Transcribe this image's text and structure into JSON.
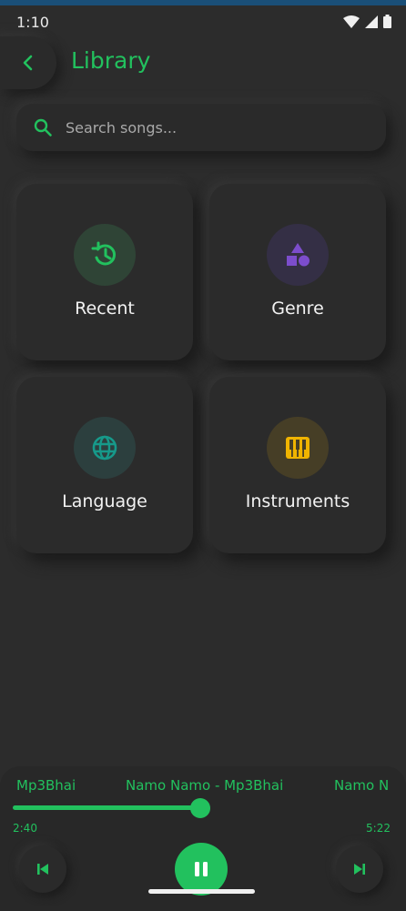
{
  "status_bar": {
    "time": "1:10"
  },
  "header": {
    "title": "Library"
  },
  "search": {
    "placeholder": "Search songs..."
  },
  "categories": [
    {
      "label": "Recent",
      "icon": "history-icon",
      "color": "#22c15e"
    },
    {
      "label": "Genre",
      "icon": "shapes-icon",
      "color": "#7c4dcc"
    },
    {
      "label": "Language",
      "icon": "globe-icon",
      "color": "#16998a"
    },
    {
      "label": "Instruments",
      "icon": "piano-icon",
      "color": "#f0b400"
    }
  ],
  "player": {
    "marquee_left": "Mp3Bhai",
    "marquee_center": "Namo Namo - Mp3Bhai",
    "marquee_right": "Namo N",
    "elapsed": "2:40",
    "total": "5:22",
    "progress": 0.497
  },
  "colors": {
    "accent": "#22c15e",
    "background": "#2c2c2c"
  }
}
